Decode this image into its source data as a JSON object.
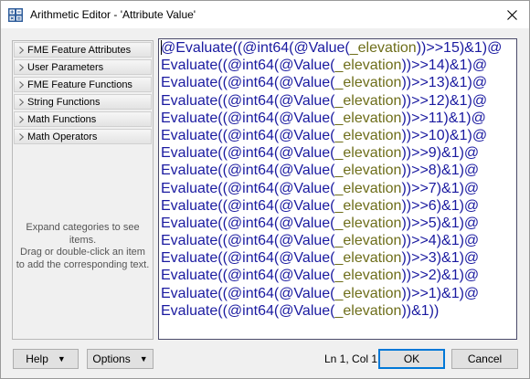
{
  "window": {
    "title": "Arithmetic Editor - 'Attribute Value'"
  },
  "sidebar": {
    "categories": [
      {
        "label": "FME Feature Attributes"
      },
      {
        "label": "User Parameters"
      },
      {
        "label": "FME Feature Functions"
      },
      {
        "label": "String Functions"
      },
      {
        "label": "Math Functions"
      },
      {
        "label": "Math Operators"
      }
    ],
    "hint": {
      "line1": "Expand categories to see items.",
      "line2": "Drag or double-click an item",
      "line3": "to add the corresponding text."
    }
  },
  "editor": {
    "lines": [
      {
        "fn1": "@Evaluate",
        "p1": "((",
        "fn2": "@int64",
        "p2": "(",
        "fn3": "@Value",
        "p3": "(",
        "attr": "_elevation",
        "tail": "))>>15)&1)@"
      },
      {
        "fn1": "Evaluate",
        "p1": "((",
        "fn2": "@int64",
        "p2": "(",
        "fn3": "@Value",
        "p3": "(",
        "attr": "_elevation",
        "tail": "))>>14)&1)@"
      },
      {
        "fn1": "Evaluate",
        "p1": "((",
        "fn2": "@int64",
        "p2": "(",
        "fn3": "@Value",
        "p3": "(",
        "attr": "_elevation",
        "tail": "))>>13)&1)@"
      },
      {
        "fn1": "Evaluate",
        "p1": "((",
        "fn2": "@int64",
        "p2": "(",
        "fn3": "@Value",
        "p3": "(",
        "attr": "_elevation",
        "tail": "))>>12)&1)@"
      },
      {
        "fn1": "Evaluate",
        "p1": "((",
        "fn2": "@int64",
        "p2": "(",
        "fn3": "@Value",
        "p3": "(",
        "attr": "_elevation",
        "tail": "))>>11)&1)@"
      },
      {
        "fn1": "Evaluate",
        "p1": "((",
        "fn2": "@int64",
        "p2": "(",
        "fn3": "@Value",
        "p3": "(",
        "attr": "_elevation",
        "tail": "))>>10)&1)@"
      },
      {
        "fn1": "Evaluate",
        "p1": "((",
        "fn2": "@int64",
        "p2": "(",
        "fn3": "@Value",
        "p3": "(",
        "attr": "_elevation",
        "tail": "))>>9)&1)@"
      },
      {
        "fn1": "Evaluate",
        "p1": "((",
        "fn2": "@int64",
        "p2": "(",
        "fn3": "@Value",
        "p3": "(",
        "attr": "_elevation",
        "tail": "))>>8)&1)@"
      },
      {
        "fn1": "Evaluate",
        "p1": "((",
        "fn2": "@int64",
        "p2": "(",
        "fn3": "@Value",
        "p3": "(",
        "attr": "_elevation",
        "tail": "))>>7)&1)@"
      },
      {
        "fn1": "Evaluate",
        "p1": "((",
        "fn2": "@int64",
        "p2": "(",
        "fn3": "@Value",
        "p3": "(",
        "attr": "_elevation",
        "tail": "))>>6)&1)@"
      },
      {
        "fn1": "Evaluate",
        "p1": "((",
        "fn2": "@int64",
        "p2": "(",
        "fn3": "@Value",
        "p3": "(",
        "attr": "_elevation",
        "tail": "))>>5)&1)@"
      },
      {
        "fn1": "Evaluate",
        "p1": "((",
        "fn2": "@int64",
        "p2": "(",
        "fn3": "@Value",
        "p3": "(",
        "attr": "_elevation",
        "tail": "))>>4)&1)@"
      },
      {
        "fn1": "Evaluate",
        "p1": "((",
        "fn2": "@int64",
        "p2": "(",
        "fn3": "@Value",
        "p3": "(",
        "attr": "_elevation",
        "tail": "))>>3)&1)@"
      },
      {
        "fn1": "Evaluate",
        "p1": "((",
        "fn2": "@int64",
        "p2": "(",
        "fn3": "@Value",
        "p3": "(",
        "attr": "_elevation",
        "tail": "))>>2)&1)@"
      },
      {
        "fn1": "Evaluate",
        "p1": "((",
        "fn2": "@int64",
        "p2": "(",
        "fn3": "@Value",
        "p3": "(",
        "attr": "_elevation",
        "tail": "))>>1)&1)@"
      },
      {
        "fn1": "Evaluate",
        "p1": "((",
        "fn2": "@int64",
        "p2": "(",
        "fn3": "@Value",
        "p3": "(",
        "attr": "_elevation",
        "tail": "))&1))"
      }
    ]
  },
  "footer": {
    "help_label": "Help",
    "options_label": "Options",
    "status": "Ln 1, Col 1",
    "ok_label": "OK",
    "cancel_label": "Cancel"
  },
  "colors": {
    "function": "#1a1aa0",
    "attribute": "#6e6e1a",
    "focus": "#0078d7"
  }
}
